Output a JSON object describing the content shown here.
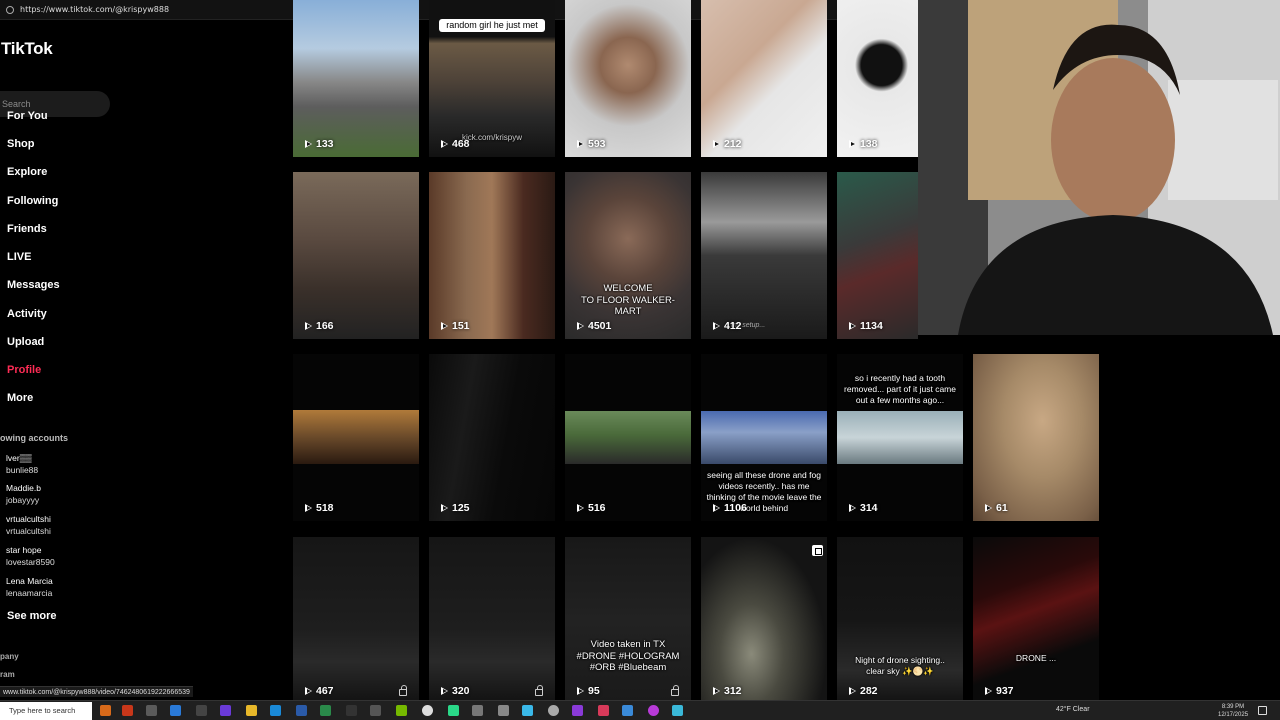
{
  "browser": {
    "url": "https://www.tiktok.com/@krispyw888"
  },
  "sidebar": {
    "logo": "TikTok",
    "search_placeholder": "Search",
    "nav": [
      {
        "label": "For You"
      },
      {
        "label": "Shop"
      },
      {
        "label": "Explore"
      },
      {
        "label": "Following"
      },
      {
        "label": "Friends"
      },
      {
        "label": "LIVE"
      },
      {
        "label": "Messages"
      },
      {
        "label": "Activity"
      },
      {
        "label": "Upload"
      },
      {
        "label": "Profile",
        "active": true
      },
      {
        "label": "More"
      }
    ],
    "following_title": "owing accounts",
    "accounts": [
      {
        "name": "lver▒▒",
        "handle": "bunlie88"
      },
      {
        "name": "Maddie.b",
        "handle": "jobayyyy"
      },
      {
        "name": "vrtualcultshi",
        "handle": "vrtualcultshi"
      },
      {
        "name": "star hope",
        "handle": "lovestar8590"
      },
      {
        "name": "Lena Marcia",
        "handle": "lenaamarcia"
      }
    ],
    "see_more": "See more",
    "footer_1": "pany",
    "footer_2": "ram"
  },
  "grid": [
    {
      "views": "133"
    },
    {
      "views": "468",
      "caption_top": "random girl he just met",
      "watermark": "kick.com/krispyw"
    },
    {
      "views": "593"
    },
    {
      "views": "212"
    },
    {
      "views": "138"
    },
    {
      "views": "166"
    },
    {
      "views": "151"
    },
    {
      "views": "4501",
      "caption": "WELCOME\nTO FLOOR WALKER-MART"
    },
    {
      "views": "412",
      "mini_caption": "my setup..."
    },
    {
      "views": "1134"
    },
    {
      "views": "518"
    },
    {
      "views": "125"
    },
    {
      "views": "516"
    },
    {
      "views": "1106",
      "caption": "seeing all these drone and fog videos recently.. has me thinking of the movie leave the world behind"
    },
    {
      "views": "314",
      "caption_top": "so i recently had a tooth removed... part of it just came out a few months ago..."
    },
    {
      "views": "61"
    },
    {
      "views": "467",
      "locked": true
    },
    {
      "views": "320",
      "locked": true
    },
    {
      "views": "95",
      "locked": true,
      "caption": "Video taken in TX\n#DRONE #HOLOGRAM\n#ORB #Bluebeam"
    },
    {
      "views": "312"
    },
    {
      "views": "282",
      "caption": "Night of drone sighting..\nclear sky ✨🌕✨"
    },
    {
      "views": "937",
      "caption": "DRONE ..."
    }
  ],
  "status_url": "www.tiktok.com/@krispyw888/video/7462480619222666539",
  "taskbar": {
    "search_placeholder": "Type here to search",
    "weather": "42°F  Clear",
    "time": "8:39 PM",
    "date": "12/17/2025"
  }
}
